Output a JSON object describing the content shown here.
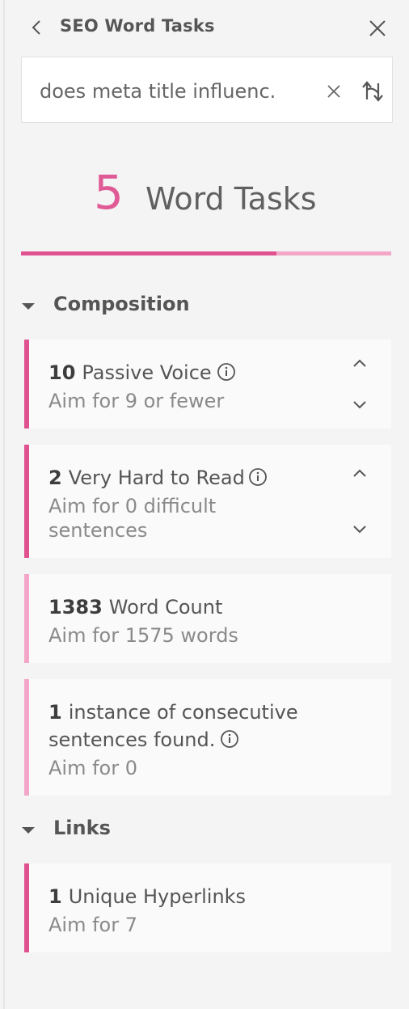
{
  "header": {
    "title": "SEO Word Tasks"
  },
  "search": {
    "value": "does meta title influenc."
  },
  "summary": {
    "count": "5",
    "label": "Word Tasks",
    "progress_fraction": 0.69
  },
  "colors": {
    "accent": "#e0518f",
    "accent_light": "#f3a6c8"
  },
  "sections": [
    {
      "title": "Composition",
      "items": [
        {
          "count": "10",
          "label": "Passive Voice",
          "aim": "Aim for 9 or fewer",
          "has_info": true,
          "priority": "high"
        },
        {
          "count": "2",
          "label": "Very Hard to Read",
          "aim": "Aim for 0 difficult sentences",
          "has_info": true,
          "priority": "high"
        },
        {
          "count": "1383",
          "label": "Word Count",
          "aim": "Aim for 1575 words",
          "has_info": false,
          "priority": "low"
        },
        {
          "count": "1",
          "label": "instance of consecutive sentences found.",
          "aim": "Aim for 0",
          "has_info": true,
          "priority": "low"
        }
      ]
    },
    {
      "title": "Links",
      "items": [
        {
          "count": "1",
          "label": "Unique Hyperlinks",
          "aim": "Aim for 7",
          "has_info": false,
          "priority": "high"
        }
      ]
    }
  ]
}
